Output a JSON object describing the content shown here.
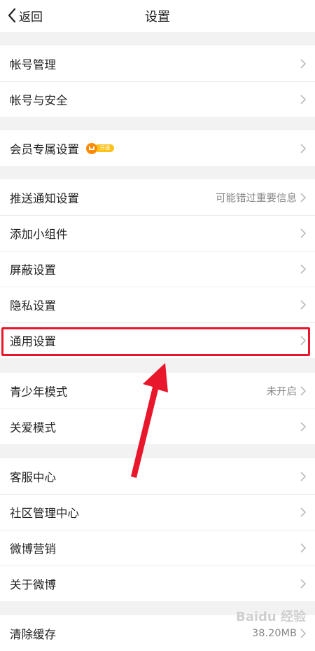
{
  "header": {
    "back_label": "返回",
    "title": "设置"
  },
  "groups": [
    {
      "items": [
        {
          "label": "帐号管理"
        },
        {
          "label": "帐号与安全"
        }
      ]
    },
    {
      "items": [
        {
          "label": "会员专属设置",
          "badge": "开通"
        }
      ]
    },
    {
      "items": [
        {
          "label": "推送通知设置",
          "value": "可能错过重要信息"
        },
        {
          "label": "添加小组件"
        },
        {
          "label": "屏蔽设置"
        },
        {
          "label": "隐私设置"
        },
        {
          "label": "通用设置"
        }
      ]
    },
    {
      "items": [
        {
          "label": "青少年模式",
          "value": "未开启"
        },
        {
          "label": "关爱模式"
        }
      ]
    },
    {
      "items": [
        {
          "label": "客服中心"
        },
        {
          "label": "社区管理中心"
        },
        {
          "label": "微博营销"
        },
        {
          "label": "关于微博"
        }
      ]
    },
    {
      "items": [
        {
          "label": "清除缓存",
          "value": "38.20MB"
        }
      ]
    }
  ],
  "watermark": "Baidu 经验",
  "colors": {
    "highlight": "#e8172b",
    "arrow": "#e8172b",
    "vip_badge": "#ffc21a"
  }
}
